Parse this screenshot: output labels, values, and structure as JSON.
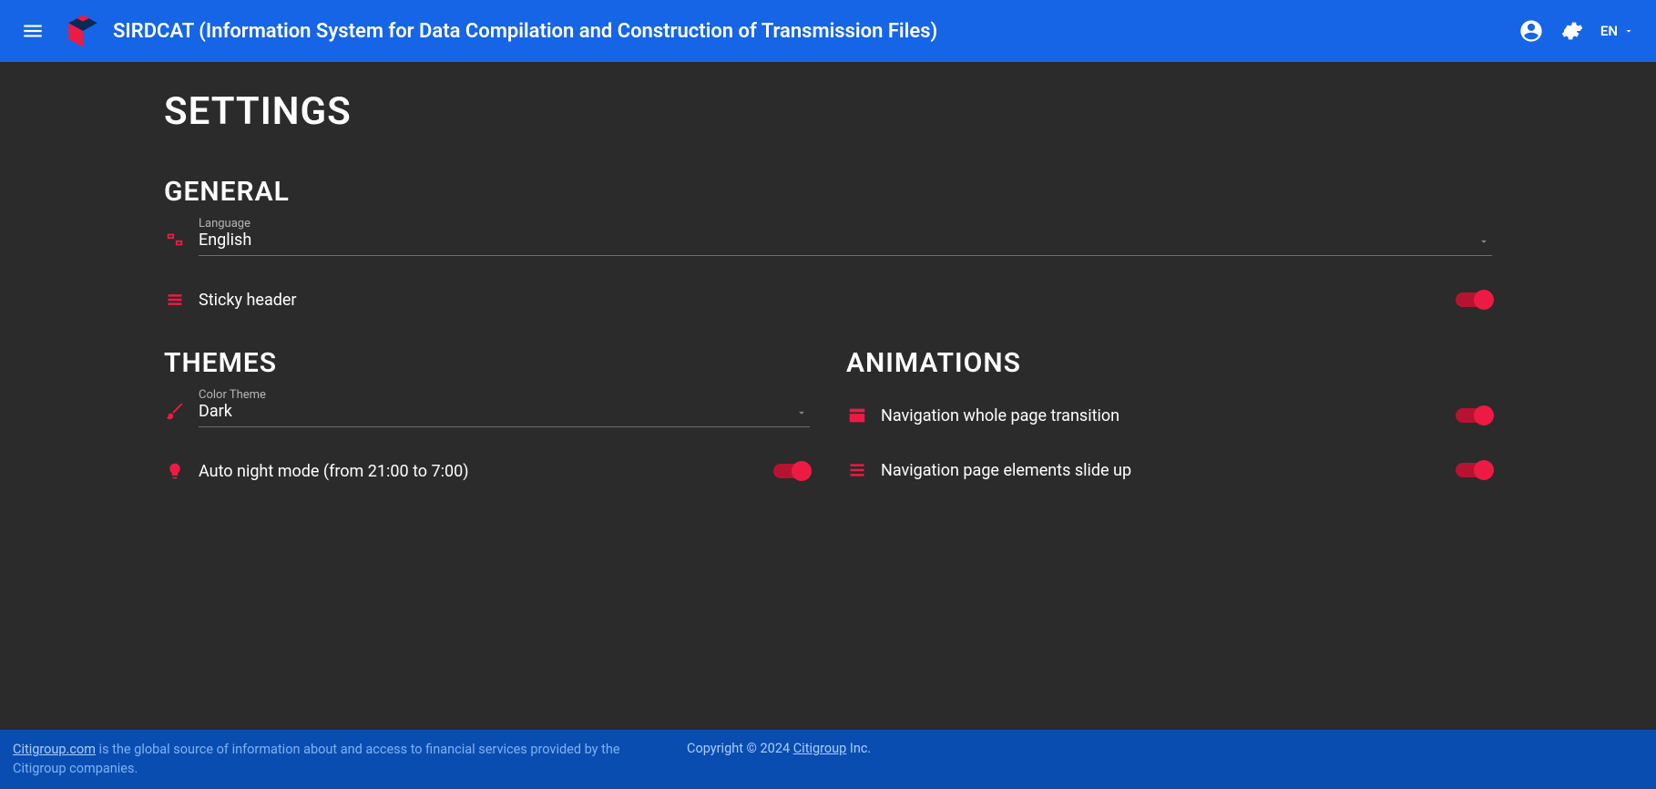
{
  "header": {
    "title": "SIRDCAT (Information System for Data Compilation and Construction of Transmission Files)",
    "lang": "EN"
  },
  "page": {
    "title": "SETTINGS"
  },
  "sections": {
    "general": {
      "title": "GENERAL",
      "language": {
        "label": "Language",
        "value": "English"
      },
      "sticky_header": {
        "label": "Sticky header",
        "on": true
      }
    },
    "themes": {
      "title": "THEMES",
      "color_theme": {
        "label": "Color Theme",
        "value": "Dark"
      },
      "auto_night": {
        "label": "Auto night mode (from 21:00 to 7:00)",
        "on": true
      }
    },
    "animations": {
      "title": "ANIMATIONS",
      "nav_page": {
        "label": "Navigation whole page transition",
        "on": true
      },
      "nav_slide": {
        "label": "Navigation page elements slide up",
        "on": true
      }
    }
  },
  "footer": {
    "link_text": "Citigroup.com",
    "desc": " is the global source of information about and access to financial services provided by the Citigroup companies.",
    "copyright_prefix": "Copyright © 2024 ",
    "copyright_link": "Citigroup",
    "copyright_suffix": " Inc."
  }
}
